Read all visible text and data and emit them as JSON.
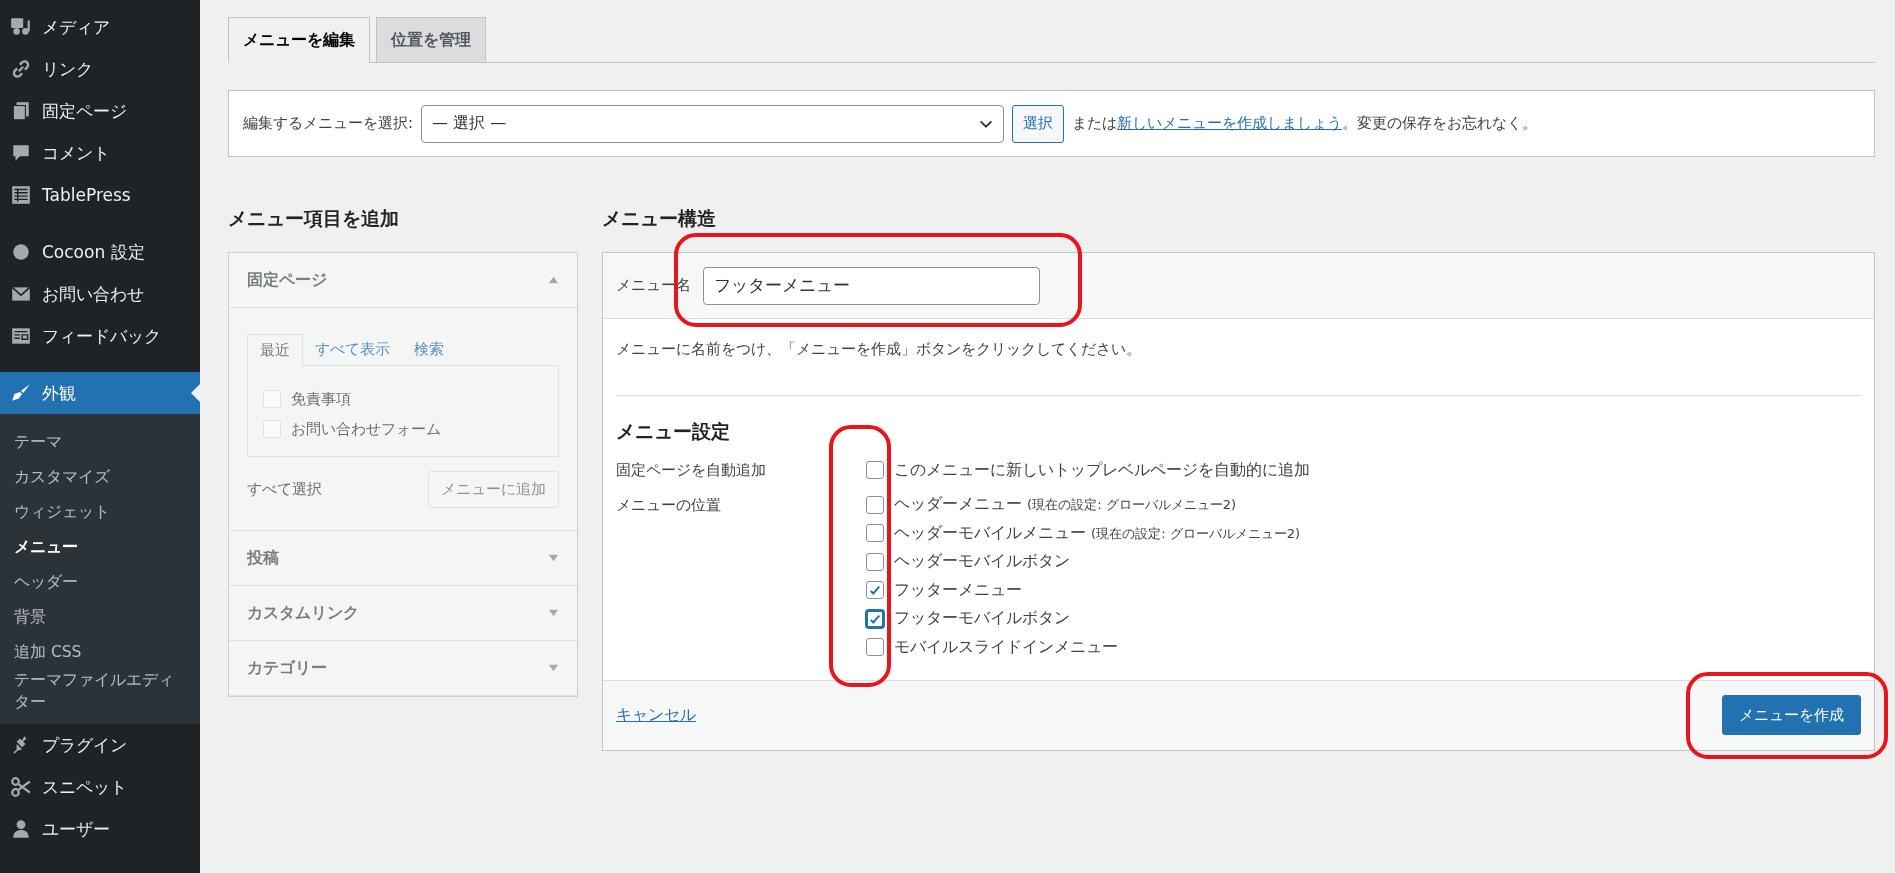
{
  "sidebar": {
    "items": [
      {
        "label": "メディア",
        "selected": false
      },
      {
        "label": "リンク",
        "selected": false
      },
      {
        "label": "固定ページ",
        "selected": false
      },
      {
        "label": "コメント",
        "selected": false
      },
      {
        "label": "TablePress",
        "selected": false
      },
      {
        "label": "Cocoon 設定",
        "selected": false
      },
      {
        "label": "お問い合わせ",
        "selected": false
      },
      {
        "label": "フィードバック",
        "selected": false
      },
      {
        "label": "外観",
        "selected": true,
        "children": [
          {
            "label": "テーマ",
            "selected": false
          },
          {
            "label": "カスタマイズ",
            "selected": false
          },
          {
            "label": "ウィジェット",
            "selected": false
          },
          {
            "label": "メニュー",
            "selected": true
          },
          {
            "label": "ヘッダー",
            "selected": false
          },
          {
            "label": "背景",
            "selected": false
          },
          {
            "label": "追加 CSS",
            "selected": false
          },
          {
            "label": "テーマファイルエディター",
            "selected": false
          }
        ]
      },
      {
        "label": "プラグイン",
        "selected": false
      },
      {
        "label": "スニペット",
        "selected": false
      },
      {
        "label": "ユーザー",
        "selected": false
      }
    ]
  },
  "tabs": [
    {
      "label": "メニューを編集",
      "selected": true
    },
    {
      "label": "位置を管理",
      "selected": false
    }
  ],
  "select_bar": {
    "label": "編集するメニューを選択:",
    "value": "— 選択 —",
    "button": "選択",
    "text": "または",
    "link": "新しいメニューを作成しましょう",
    "text_after": "。変更の保存をお忘れなく。"
  },
  "add_items": {
    "heading": "メニュー項目を追加",
    "disabled": true,
    "sections": [
      {
        "title": "固定ページ",
        "expanded": true,
        "tabs": [
          {
            "label": "最近",
            "selected": true
          },
          {
            "label": "すべて表示",
            "selected": false
          },
          {
            "label": "検索",
            "selected": false
          }
        ],
        "items": [
          {
            "label": "免責事項",
            "checked": false
          },
          {
            "label": "お問い合わせフォーム",
            "checked": false
          }
        ],
        "select_all": "すべて選択",
        "button": "メニューに追加"
      },
      {
        "title": "投稿",
        "expanded": false
      },
      {
        "title": "カスタムリンク",
        "expanded": false
      },
      {
        "title": "カテゴリー",
        "expanded": false
      }
    ]
  },
  "structure": {
    "heading": "メニュー構造",
    "name_label": "メニュー名",
    "name_value": "フッターメニュー",
    "instruction": "メニューに名前をつけ、「メニューを作成」ボタンをクリックしてください。",
    "settings_heading": "メニュー設定",
    "settings": [
      {
        "label": "固定ページを自動追加",
        "options": [
          {
            "label": "このメニューに新しいトップレベルページを自動的に追加",
            "checked": false,
            "focused": false
          }
        ]
      },
      {
        "label": "メニューの位置",
        "options": [
          {
            "label": "ヘッダーメニュー",
            "note": "(現在の設定: グローバルメニュー2)",
            "checked": false,
            "focused": false
          },
          {
            "label": "ヘッダーモバイルメニュー",
            "note": "(現在の設定: グローバルメニュー2)",
            "checked": false,
            "focused": false
          },
          {
            "label": "ヘッダーモバイルボタン",
            "checked": false,
            "focused": false
          },
          {
            "label": "フッターメニュー",
            "checked": true,
            "focused": false
          },
          {
            "label": "フッターモバイルボタン",
            "checked": true,
            "focused": true
          },
          {
            "label": "モバイルスライドインメニュー",
            "checked": false,
            "focused": false
          }
        ]
      }
    ],
    "cancel": "キャンセル",
    "create_button": "メニューを作成"
  }
}
